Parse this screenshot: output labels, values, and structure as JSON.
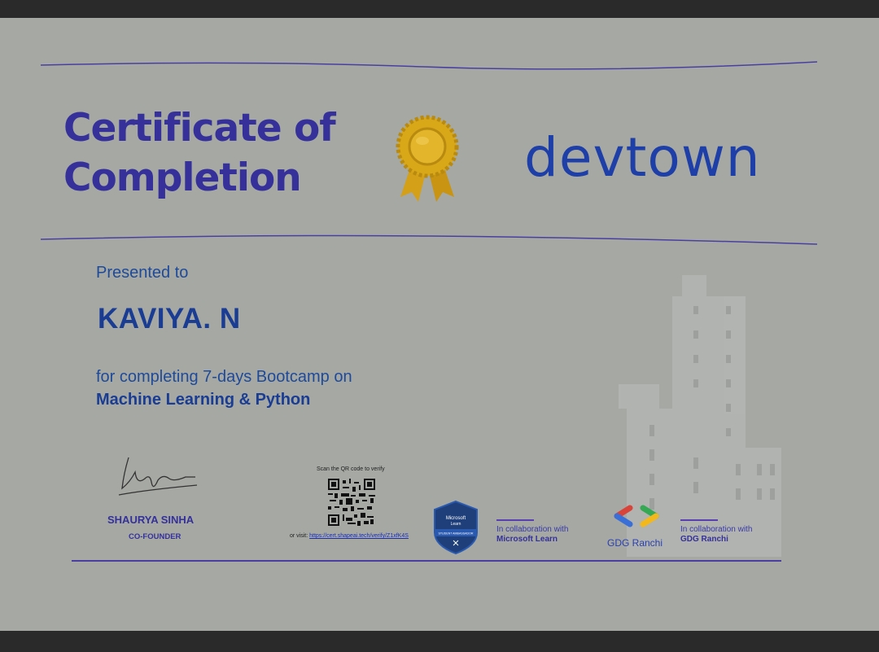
{
  "certificate": {
    "title_line1": "Certificate of",
    "title_line2": "Completion",
    "logo_text": "devtown",
    "presented_label": "Presented to",
    "recipient_name": "KAVIYA. N",
    "description": "for completing 7-days Bootcamp on",
    "course": "Machine Learning & Python"
  },
  "signatory": {
    "name": "SHAURYA SINHA",
    "role": "CO-FOUNDER"
  },
  "verification": {
    "scan_text": "Scan the QR code to verify",
    "visit_prefix": "or visit:",
    "url": "https://cert.shapeai.tech/verify/Z1xfK4S"
  },
  "partners": {
    "badge_line1": "Microsoft",
    "badge_line2": "Learn",
    "badge_ribbon": "STUDENT AMBASSADOR",
    "collab1_label": "In collaboration with",
    "collab1_name": "Microsoft Learn",
    "gdg_logo_text": "GDG Ranchi",
    "collab2_label": "In collaboration with",
    "collab2_name": "GDG Ranchi"
  },
  "colors": {
    "background": "#a5a8a3",
    "title_purple": "#35309a",
    "body_blue": "#1f4a9a",
    "medal_gold": "#d4a017"
  },
  "icons": [
    "award-medal-icon",
    "qr-code-icon",
    "microsoft-learn-badge-icon",
    "gdg-logo-icon"
  ]
}
